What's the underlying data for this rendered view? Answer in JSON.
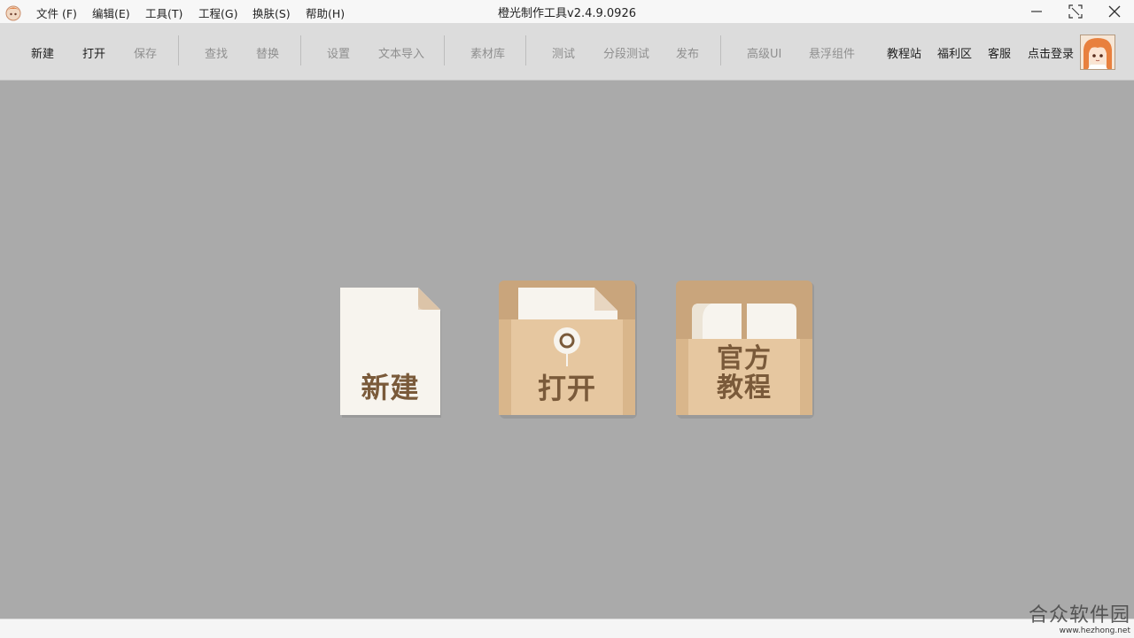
{
  "window": {
    "title": "橙光制作工具v2.4.9.0926"
  },
  "menu": {
    "items": [
      {
        "label": "文件 (F)"
      },
      {
        "label": "编辑(E)"
      },
      {
        "label": "工具(T)"
      },
      {
        "label": "工程(G)"
      },
      {
        "label": "换肤(S)"
      },
      {
        "label": "帮助(H)"
      }
    ]
  },
  "toolbar": {
    "new": "新建",
    "open": "打开",
    "save": "保存",
    "find": "查找",
    "replace": "替换",
    "settings": "设置",
    "text_import": "文本导入",
    "assets": "素材库",
    "test": "测试",
    "segment_test": "分段测试",
    "publish": "发布",
    "advanced_ui": "高级UI",
    "float_widget": "悬浮组件",
    "tutorial_site": "教程站",
    "welfare": "福利区",
    "support": "客服",
    "login": "点击登录"
  },
  "cards": {
    "new_label": "新建",
    "open_label": "打开",
    "tutorial_line1": "官方",
    "tutorial_line2": "教程"
  },
  "watermark": {
    "main": "合众软件园",
    "url": "www.hezhong.net"
  },
  "colors": {
    "background": "#aaaaaa",
    "toolbar": "#dcdcdc",
    "card_tan": "#e6c7a0",
    "card_dark": "#c8a57c",
    "card_text": "#7a5a3a",
    "paper": "#f7f4ee"
  }
}
